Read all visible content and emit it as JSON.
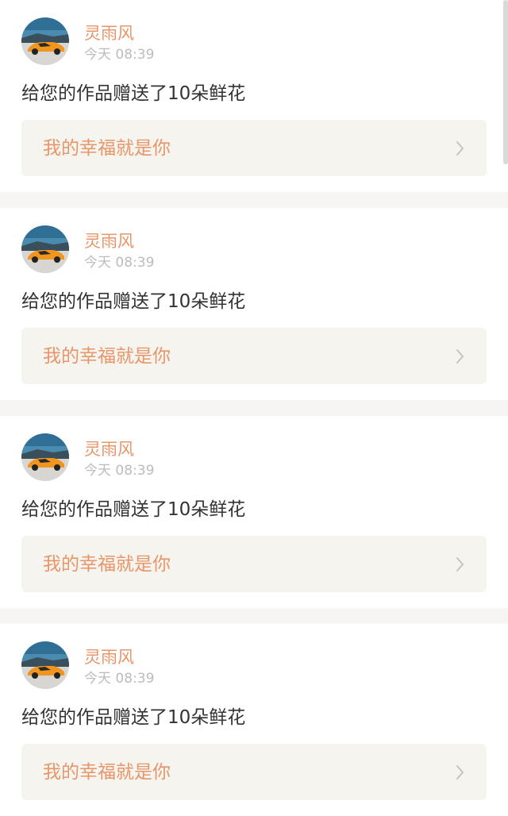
{
  "notifications": [
    {
      "username": "灵雨风",
      "time": "今天 08:39",
      "message": "给您的作品赠送了10朵鲜花",
      "work_title": "我的幸福就是你",
      "avatar_icon": "orange-sports-car-avatar",
      "chevron_icon": "chevron-right-icon"
    },
    {
      "username": "灵雨风",
      "time": "今天 08:39",
      "message": "给您的作品赠送了10朵鲜花",
      "work_title": "我的幸福就是你",
      "avatar_icon": "orange-sports-car-avatar",
      "chevron_icon": "chevron-right-icon"
    },
    {
      "username": "灵雨风",
      "time": "今天 08:39",
      "message": "给您的作品赠送了10朵鲜花",
      "work_title": "我的幸福就是你",
      "avatar_icon": "orange-sports-car-avatar",
      "chevron_icon": "chevron-right-icon"
    },
    {
      "username": "灵雨风",
      "time": "今天 08:39",
      "message": "给您的作品赠送了10朵鲜花",
      "work_title": "我的幸福就是你",
      "avatar_icon": "orange-sports-car-avatar",
      "chevron_icon": "chevron-right-icon"
    }
  ],
  "colors": {
    "accent": "#e8956a",
    "page_background": "#f6f5f3",
    "link_background": "#f5f4ee",
    "time_text": "#bcbcbc",
    "message_text": "#333333"
  }
}
